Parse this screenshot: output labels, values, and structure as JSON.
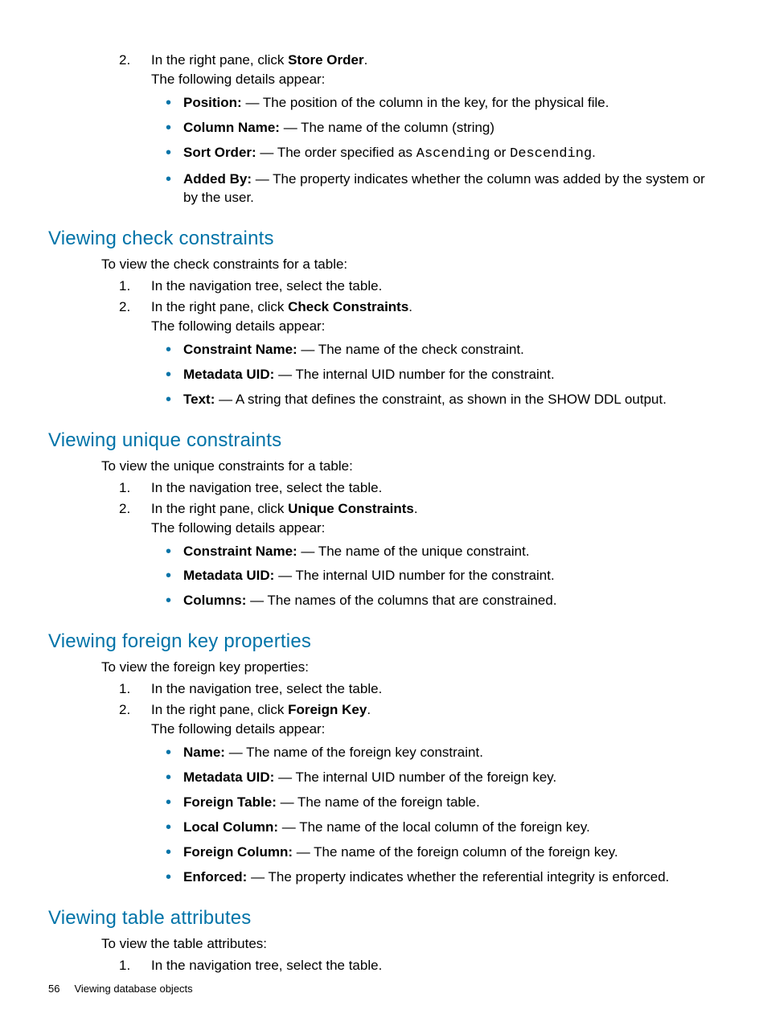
{
  "section0": {
    "step2_prefix": "In the right pane, click ",
    "step2_bold": "Store Order",
    "step2_suffix": ".",
    "detailsLead": "The following details appear:",
    "items": [
      {
        "term": "Position:",
        "desc": " — The position of the column in the key, for the physical file."
      },
      {
        "term": "Column Name:",
        "desc": " — The name of the column (string)"
      },
      {
        "term": "Sort Order:",
        "desc_pre": " — The order specified as ",
        "code1": "Ascending",
        "mid": " or ",
        "code2": "Descending",
        "desc_post": "."
      },
      {
        "term": "Added By:",
        "desc": " — The property indicates whether the column was added by the system or by the user."
      }
    ]
  },
  "sectionA": {
    "heading": "Viewing check constraints",
    "intro": "To view the check constraints for a table:",
    "step1": "In the navigation tree, select the table.",
    "step2_prefix": "In the right pane, click ",
    "step2_bold": "Check Constraints",
    "step2_suffix": ".",
    "detailsLead": "The following details appear:",
    "items": [
      {
        "term": "Constraint Name:",
        "desc": " — The name of the check constraint."
      },
      {
        "term": "Metadata UID:",
        "desc": " — The internal UID number for the constraint."
      },
      {
        "term": "Text:",
        "desc": " — A string that defines the constraint, as shown in the SHOW DDL output."
      }
    ]
  },
  "sectionB": {
    "heading": "Viewing unique constraints",
    "intro": "To view the unique constraints for a table:",
    "step1": "In the navigation tree, select the table.",
    "step2_prefix": "In the right pane, click ",
    "step2_bold": "Unique Constraints",
    "step2_suffix": ".",
    "detailsLead": "The following details appear:",
    "items": [
      {
        "term": "Constraint Name:",
        "desc": " — The name of the unique constraint."
      },
      {
        "term": "Metadata UID:",
        "desc": " — The internal UID number for the constraint."
      },
      {
        "term": "Columns:",
        "desc": " — The names of the columns that are constrained."
      }
    ]
  },
  "sectionC": {
    "heading": "Viewing foreign key properties",
    "intro": "To view the foreign key properties:",
    "step1": "In the navigation tree, select the table.",
    "step2_prefix": "In the right pane, click ",
    "step2_bold": "Foreign Key",
    "step2_suffix": ".",
    "detailsLead": "The following details appear:",
    "items": [
      {
        "term": "Name:",
        "desc": " — The name of the foreign key constraint."
      },
      {
        "term": "Metadata UID:",
        "desc": " — The internal UID number of the foreign key."
      },
      {
        "term": "Foreign Table:",
        "desc": " — The name of the foreign table."
      },
      {
        "term": "Local Column:",
        "desc": " — The name of the local column of the foreign key."
      },
      {
        "term": "Foreign Column:",
        "desc": " — The name of the foreign column of the foreign key."
      },
      {
        "term": "Enforced:",
        "desc": " — The property indicates whether the referential integrity is enforced."
      }
    ]
  },
  "sectionD": {
    "heading": "Viewing table attributes",
    "intro": "To view the table attributes:",
    "step1": "In the navigation tree, select the table."
  },
  "footer": {
    "page": "56",
    "chapter": "Viewing database objects"
  }
}
